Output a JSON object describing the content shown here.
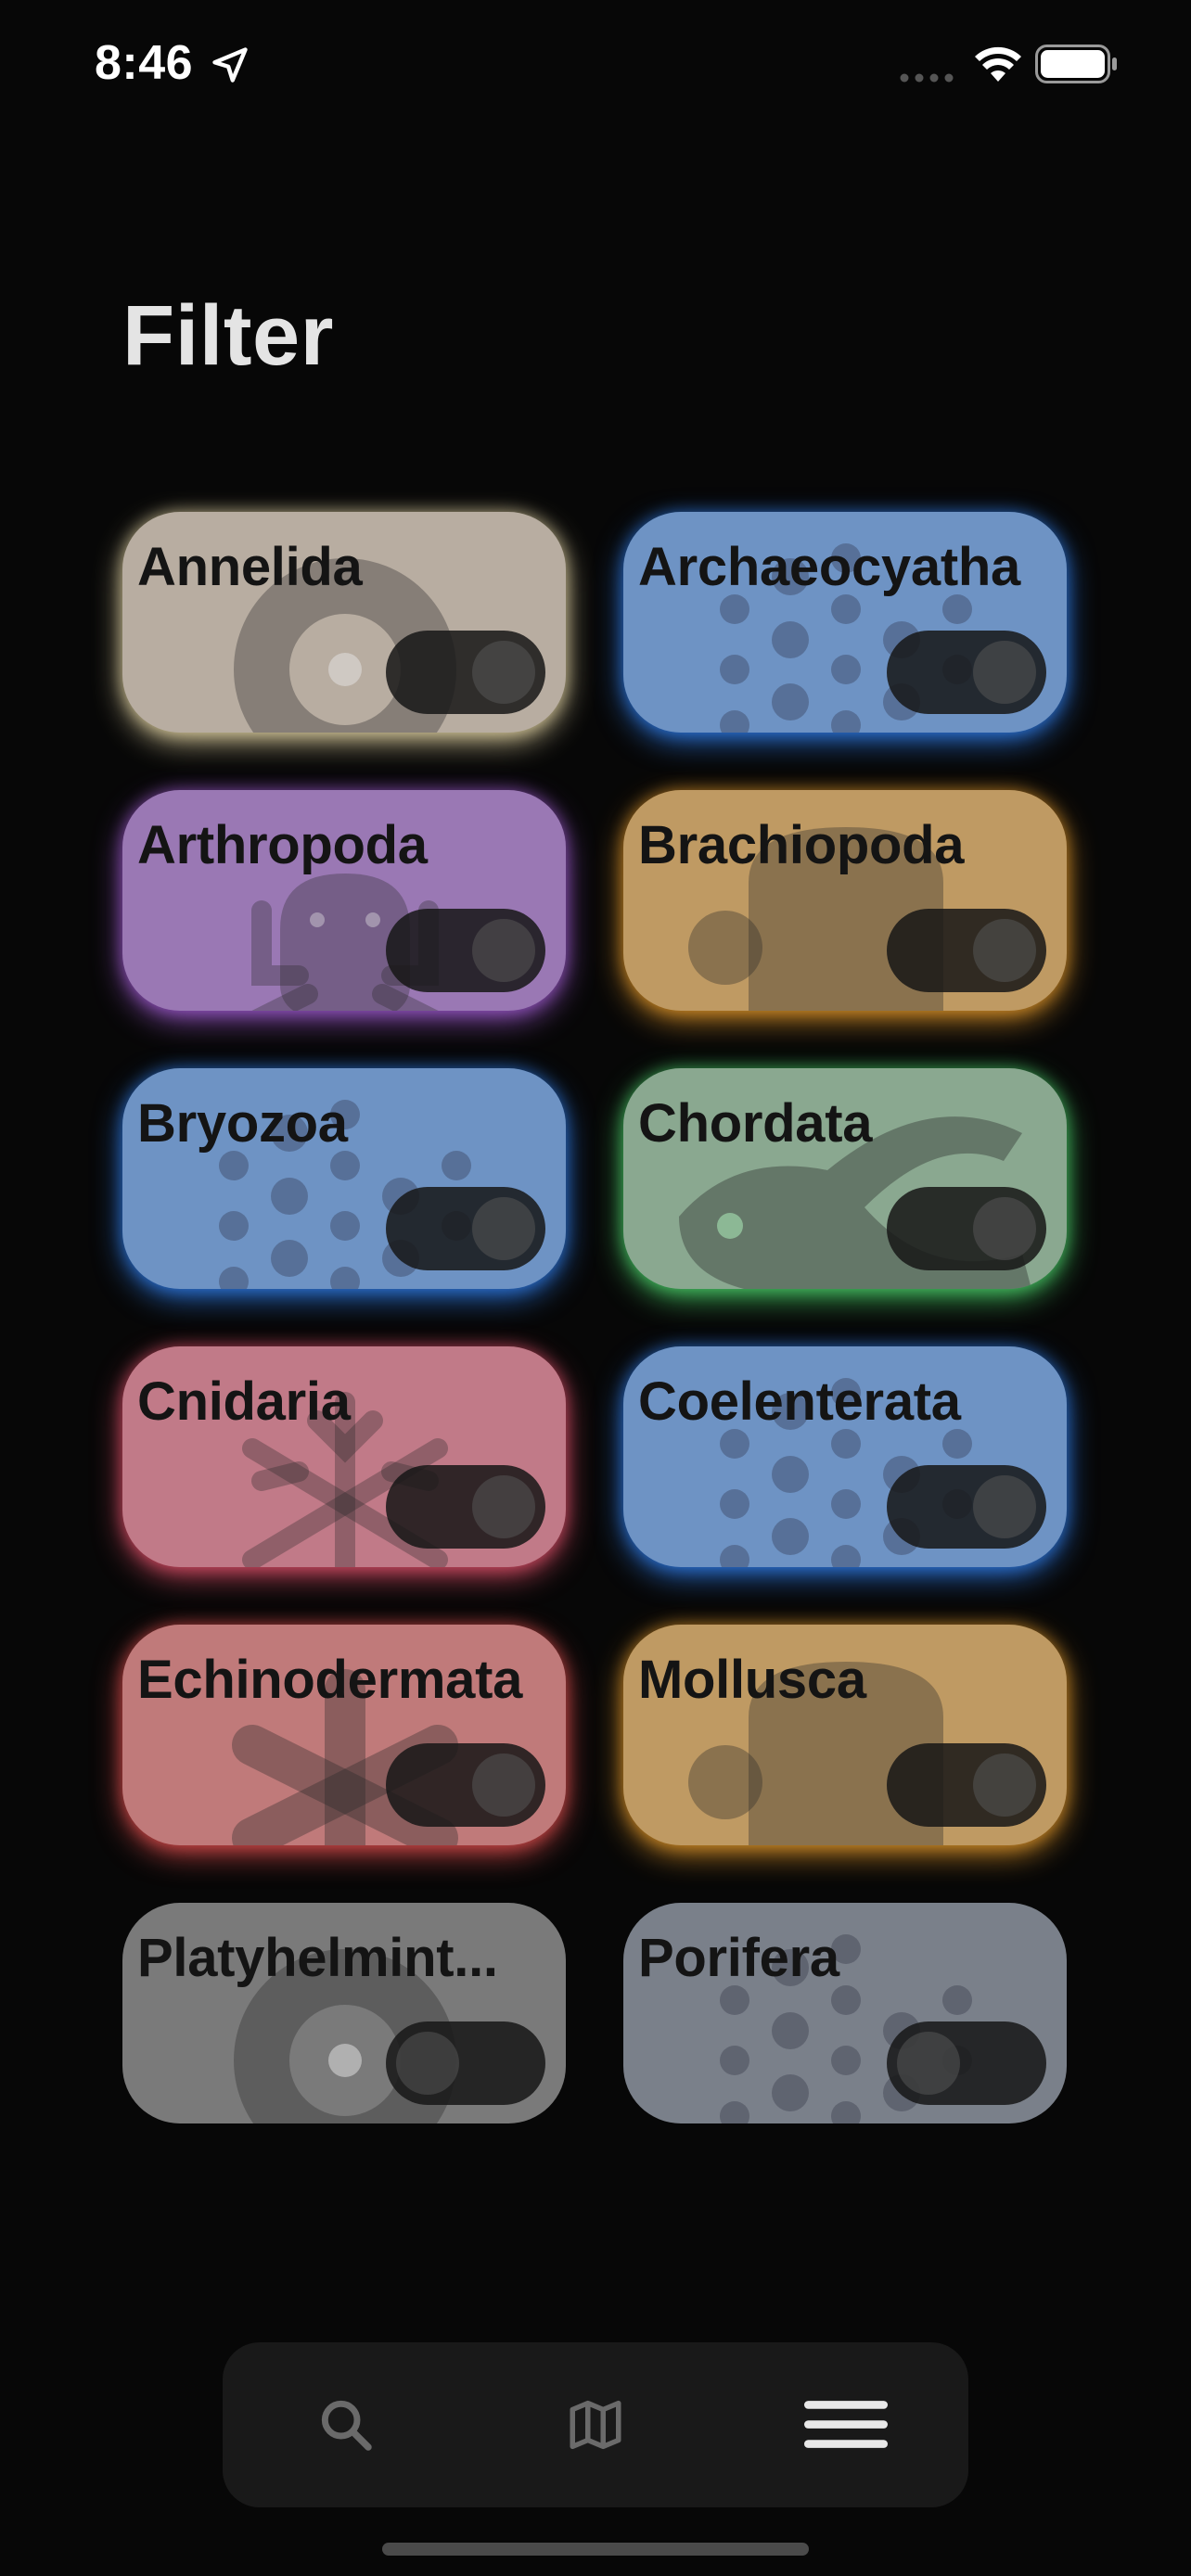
{
  "status_bar": {
    "time": "8:46"
  },
  "page_title": "Filter",
  "phyla": [
    {
      "label": "Annelida",
      "color": "#b8ada1",
      "glow": "#e8d9a8",
      "art": "worm",
      "enabled": true
    },
    {
      "label": "Archaeocyatha",
      "color": "#6e93c4",
      "glow": "#2f7be6",
      "art": "dots",
      "enabled": true
    },
    {
      "label": "Arthropoda",
      "color": "#9a78b4",
      "glow": "#a05bd0",
      "art": "bug",
      "enabled": true
    },
    {
      "label": "Brachiopoda",
      "color": "#bf9a63",
      "glow": "#e0962a",
      "art": "shell",
      "enabled": true
    },
    {
      "label": "Bryozoa",
      "color": "#6e93c4",
      "glow": "#2f7be6",
      "art": "dots",
      "enabled": true
    },
    {
      "label": "Chordata",
      "color": "#8aa890",
      "glow": "#4bd16a",
      "art": "fish",
      "enabled": true
    },
    {
      "label": "Cnidaria",
      "color": "#c17a88",
      "glow": "#e0506a",
      "art": "flake",
      "enabled": true
    },
    {
      "label": "Coelenterata",
      "color": "#6e93c4",
      "glow": "#2f7be6",
      "art": "dots",
      "enabled": true
    },
    {
      "label": "Echinodermata",
      "color": "#c07a7a",
      "glow": "#e04e4e",
      "art": "star",
      "enabled": true
    },
    {
      "label": "Mollusca",
      "color": "#bf9a63",
      "glow": "#e0962a",
      "art": "shell",
      "enabled": true
    },
    {
      "label": "Platyhelmint...",
      "color": "#7a7a7a",
      "glow": null,
      "art": "worm",
      "enabled": false
    },
    {
      "label": "Porifera",
      "color": "#7a808a",
      "glow": null,
      "art": "dots",
      "enabled": false
    }
  ],
  "tab_bar": {
    "items": [
      {
        "icon": "search-icon",
        "active": false
      },
      {
        "icon": "map-icon",
        "active": false
      },
      {
        "icon": "menu-icon",
        "active": true
      }
    ]
  }
}
